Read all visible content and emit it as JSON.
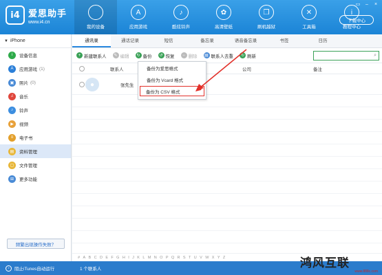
{
  "app": {
    "name": "爱思助手",
    "url": "www.i4.cn",
    "logo_badge": "i4"
  },
  "window_buttons": [
    "▭",
    "–",
    "×"
  ],
  "download_button": "下载中心",
  "nav": [
    {
      "label": "我的设备",
      "icon": "apple-icon",
      "glyph": "",
      "active": true
    },
    {
      "label": "应用游戏",
      "icon": "app-store-icon",
      "glyph": "A"
    },
    {
      "label": "酷炫铃声",
      "icon": "bell-icon",
      "glyph": "♪"
    },
    {
      "label": "高清壁纸",
      "icon": "wallpaper-icon",
      "glyph": "✿"
    },
    {
      "label": "刷机越狱",
      "icon": "box-icon",
      "glyph": "❒"
    },
    {
      "label": "工具箱",
      "icon": "tools-icon",
      "glyph": "✕"
    },
    {
      "label": "教程中心",
      "icon": "info-icon",
      "glyph": "i"
    }
  ],
  "sidebar": {
    "device": "iPhone",
    "items": [
      {
        "label": "设备信息",
        "count": "",
        "icon": "device-info-icon",
        "color": "#2eaa4a",
        "glyph": "i"
      },
      {
        "label": "应用游戏",
        "count": "(1)",
        "icon": "apps-icon",
        "color": "#2b7fd8",
        "glyph": "A"
      },
      {
        "label": "照片",
        "count": "(0)",
        "icon": "photos-icon",
        "color": "#4a8bd6",
        "glyph": "▣"
      },
      {
        "label": "音乐",
        "count": "",
        "icon": "music-icon",
        "color": "#e0463c",
        "glyph": "♫"
      },
      {
        "label": "铃声",
        "count": "",
        "icon": "ringtone-icon",
        "color": "#3c8ee0",
        "glyph": "♪"
      },
      {
        "label": "视频",
        "count": "",
        "icon": "video-icon",
        "color": "#e8a13a",
        "glyph": "▶"
      },
      {
        "label": "电子书",
        "count": "",
        "icon": "ebook-icon",
        "color": "#e3a02c",
        "glyph": "≡"
      },
      {
        "label": "资料管理",
        "count": "",
        "icon": "data-manage-icon",
        "color": "#e8b73a",
        "glyph": "▤",
        "active": true
      },
      {
        "label": "文件管理",
        "count": "",
        "icon": "file-manage-icon",
        "color": "#e8b73a",
        "glyph": "▢"
      },
      {
        "label": "更多功能",
        "count": "",
        "icon": "more-icon",
        "color": "#4a8bd6",
        "glyph": "⊞"
      }
    ],
    "help_button": "频繁出现操作失败？"
  },
  "tabs": [
    "通讯录",
    "通话记录",
    "短信",
    "备忘录",
    "语音备忘录",
    "书签",
    "日历"
  ],
  "toolbar": [
    {
      "label": "新建联系人",
      "icon": "add-icon",
      "color": "#3aa157",
      "glyph": "+"
    },
    {
      "label": "编辑",
      "icon": "edit-icon",
      "color": "#bbb",
      "glyph": "✎",
      "disabled": true
    },
    {
      "label": "备份",
      "icon": "backup-icon",
      "color": "#3aa157",
      "glyph": "↻"
    },
    {
      "label": "恢复",
      "icon": "restore-icon",
      "color": "#3aa157",
      "glyph": "↺"
    },
    {
      "label": "删除",
      "icon": "delete-icon",
      "color": "#bbb",
      "glyph": "−",
      "disabled": true
    },
    {
      "label": "联系人去重",
      "icon": "dedupe-icon",
      "color": "#4a8bd6",
      "glyph": "▤"
    },
    {
      "label": "刷新",
      "icon": "refresh-icon",
      "color": "#3aa157",
      "glyph": "↻"
    }
  ],
  "search": {
    "placeholder": ""
  },
  "table": {
    "columns": [
      "联系人",
      "公司",
      "备注"
    ],
    "rows": [
      {
        "name": "张先生",
        "company": "",
        "note": ""
      }
    ]
  },
  "dropdown": [
    "备份为爱思格式",
    "备份为 Vcard 格式",
    "备份为 CSV 格式"
  ],
  "alphabet": [
    "#",
    "A",
    "B",
    "C",
    "D",
    "E",
    "F",
    "G",
    "H",
    "I",
    "J",
    "K",
    "L",
    "M",
    "N",
    "O",
    "P",
    "Q",
    "R",
    "S",
    "T",
    "U",
    "V",
    "W",
    "X",
    "Y",
    "Z"
  ],
  "footer": {
    "itunes": "阻止iTunes自动运行",
    "count": "1 个联系人"
  },
  "watermark": {
    "title": "鸿风互联",
    "url": "www.888c.com"
  },
  "colors": {
    "header_top": "#3aa0e8",
    "header_bottom": "#1b84d6",
    "highlight": "#e2302a",
    "footer": "#2b7ccc"
  }
}
